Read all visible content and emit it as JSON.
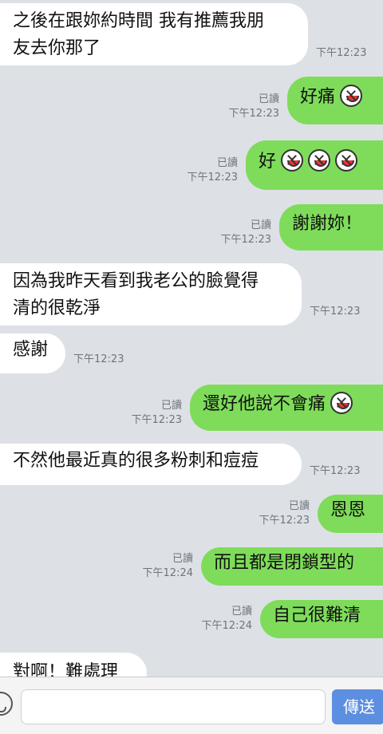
{
  "messages": [
    {
      "dir": "in",
      "lines": [
        "之後在跟妳約時間 我有推薦我朋",
        "友去你那了"
      ],
      "time": "下午12:23"
    },
    {
      "dir": "out",
      "text": "好痛",
      "emoji": [
        "tear-face-icon"
      ],
      "read": "已讀",
      "time": "下午12:23"
    },
    {
      "dir": "out",
      "text": "好",
      "emoji": [
        "grin-face-icon",
        "grin-face-icon",
        "grin-face-icon"
      ],
      "read": "已讀",
      "time": "下午12:23"
    },
    {
      "dir": "out",
      "text": "謝謝妳！",
      "read": "已讀",
      "time": "下午12:23"
    },
    {
      "dir": "in",
      "lines": [
        "因為我昨天看到我老公的臉覺得",
        "清的很乾淨"
      ],
      "time": "下午12:23"
    },
    {
      "dir": "in",
      "lines": [
        "感謝"
      ],
      "time": "下午12:23"
    },
    {
      "dir": "out",
      "text": "還好他說不會痛",
      "emoji": [
        "grin-face-icon"
      ],
      "read": "已讀",
      "time": "下午12:23"
    },
    {
      "dir": "in",
      "lines": [
        "不然他最近真的很多粉刺和痘痘"
      ],
      "time": "下午12:23"
    },
    {
      "dir": "out",
      "text": "恩恩",
      "read": "已讀",
      "time": "下午12:23"
    },
    {
      "dir": "out",
      "text": "而且都是閉鎖型的",
      "read": "已讀",
      "time": "下午12:24"
    },
    {
      "dir": "out",
      "text": "自己很難清",
      "read": "已讀",
      "time": "下午12:24"
    },
    {
      "dir": "in",
      "lines": [
        "對啊！難處理"
      ],
      "time": ""
    }
  ],
  "composer": {
    "placeholder": "",
    "send_label": "傳送",
    "emoji_icon": "smiley-icon"
  },
  "colors": {
    "background": "#dde1e6",
    "incoming_bubble": "#ffffff",
    "outgoing_bubble": "#7fdc5a",
    "send_button": "#5d8fe0"
  }
}
